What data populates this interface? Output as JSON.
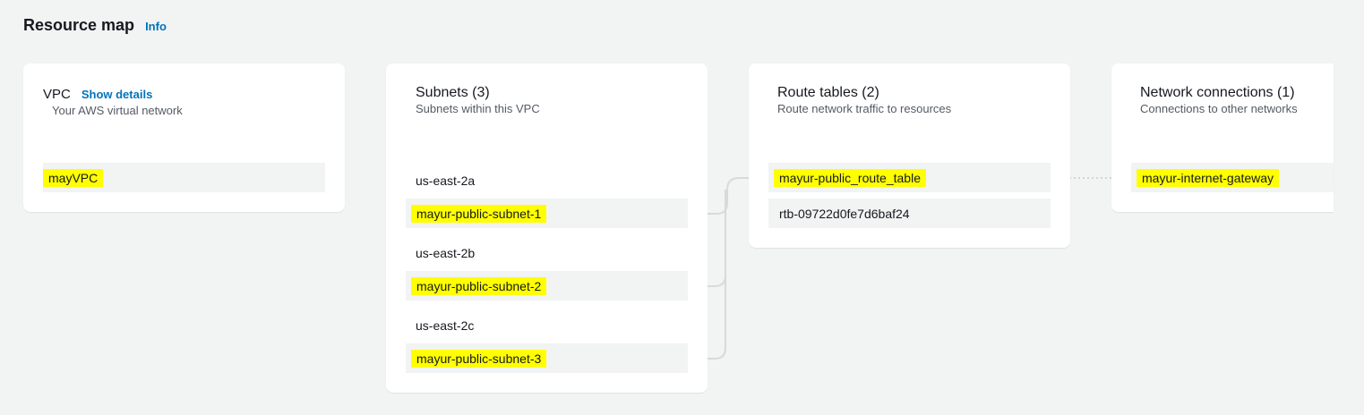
{
  "header": {
    "title": "Resource map",
    "info_label": "Info"
  },
  "vpc": {
    "title": "VPC",
    "show_details": "Show details",
    "subtitle": "Your AWS virtual network",
    "name": "mayVPC"
  },
  "subnets": {
    "title": "Subnets (3)",
    "subtitle": "Subnets within this VPC",
    "groups": [
      {
        "az": "us-east-2a",
        "name": "mayur-public-subnet-1"
      },
      {
        "az": "us-east-2b",
        "name": "mayur-public-subnet-2"
      },
      {
        "az": "us-east-2c",
        "name": "mayur-public-subnet-3"
      }
    ]
  },
  "route_tables": {
    "title": "Route tables (2)",
    "subtitle": "Route network traffic to resources",
    "items": [
      "mayur-public_route_table",
      "rtb-09722d0fe7d6baf24"
    ]
  },
  "network": {
    "title": "Network connections (1)",
    "subtitle": "Connections to other networks",
    "items": [
      "mayur-internet-gateway"
    ]
  },
  "colors": {
    "highlight": "#ffff00",
    "link": "#0073bb",
    "background": "#f2f3f3"
  }
}
